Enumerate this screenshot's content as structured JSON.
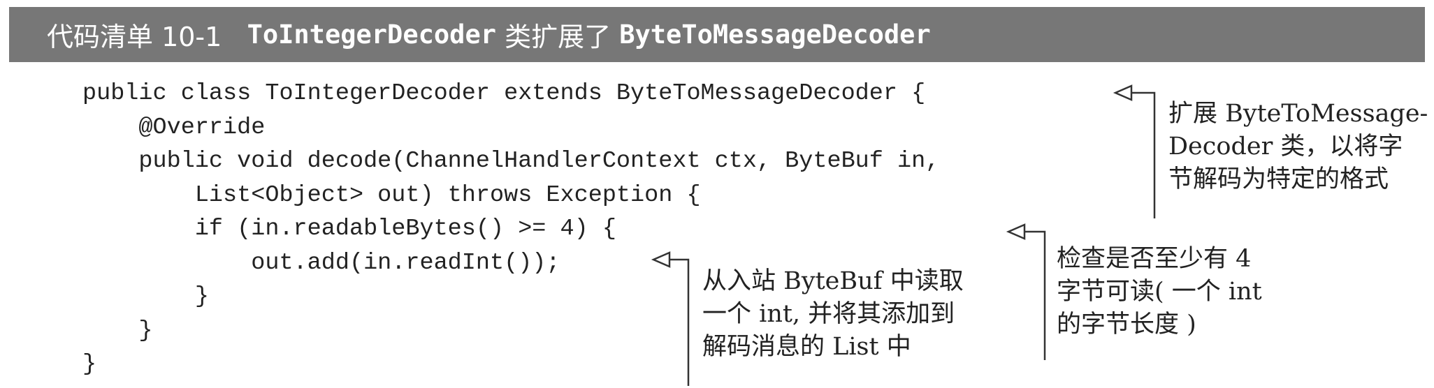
{
  "header": {
    "label": "代码清单 10-1",
    "class_name": "ToIntegerDecoder",
    "middle_text": "类扩展了",
    "base_class": "ByteToMessageDecoder"
  },
  "code_lines": [
    "public class ToIntegerDecoder extends ByteToMessageDecoder {",
    "    @Override",
    "    public void decode(ChannelHandlerContext ctx, ByteBuf in,",
    "        List<Object> out) throws Exception {",
    "        if (in.readableBytes() >= 4) {",
    "            out.add(in.readInt());",
    "        }",
    "    }",
    "}"
  ],
  "callouts": {
    "extends": [
      "扩展 ByteToMessage-",
      "Decoder 类，以将字",
      "节解码为特定的格式"
    ],
    "check": [
      "检查是否至少有 4",
      "字节可读( 一个 int",
      "的字节长度 )"
    ],
    "read": [
      "从入站 ByteBuf 中读取",
      "一个 int, 并将其添加到",
      "解码消息的 List 中"
    ]
  },
  "colors": {
    "header_bg": "#777777",
    "header_text": "#ffffff",
    "text": "#222222",
    "line": "#333333"
  }
}
